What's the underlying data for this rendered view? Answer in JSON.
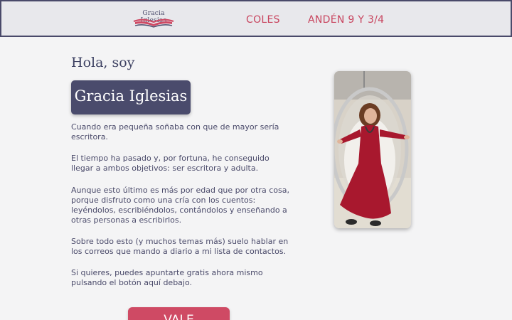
{
  "header": {
    "logo_text": "Gracia Iglesias",
    "nav": [
      {
        "label": "COLES"
      },
      {
        "label": "ANDÉN 9 Y 3/4"
      }
    ]
  },
  "intro": {
    "greeting": "Hola, soy",
    "name": "Gracia Iglesias",
    "paragraphs": [
      "Cuando era pequeña soñaba con que de mayor sería escritora.",
      "El tiempo ha pasado y, por fortuna, he conseguido llegar a ambos objetivos: ser escritora y adulta.",
      "Aunque esto último es más por edad que por otra cosa, porque disfruto como una cría con los cuentos: leyéndolos, escribiéndolos, contándolos y enseñando a otras personas a escribirlos.",
      "Sobre todo esto (y muchos temas más) suelo hablar en los correos que mando a diario a mi lista de contactos.",
      "Si quieres, puedes apuntarte gratis ahora mismo pulsando el botón aquí debajo."
    ],
    "cta_label": "VALE"
  },
  "colors": {
    "accent": "#cf4a64",
    "navy": "#4a4b6c",
    "background": "#f4f4f5"
  }
}
